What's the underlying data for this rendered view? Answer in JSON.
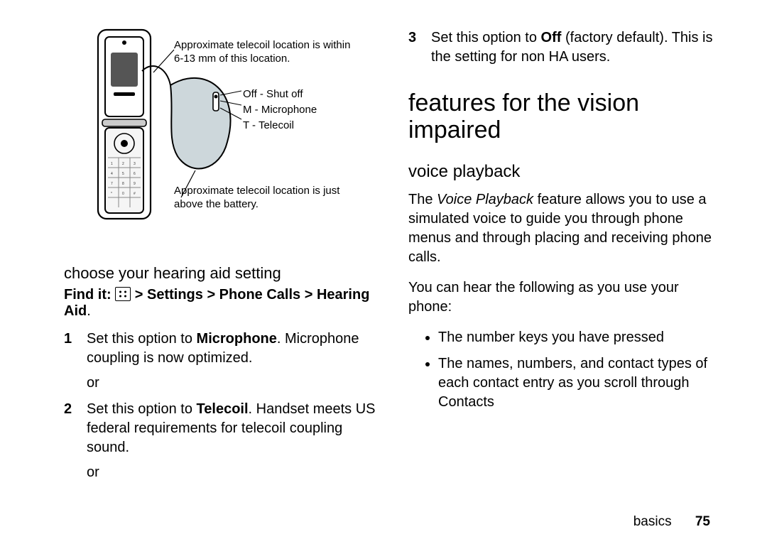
{
  "diagram": {
    "label_top": "Approximate telecoil location is within 6-13 mm of this location.",
    "legend_off": "Off - Shut off",
    "legend_m": "M - Microphone",
    "legend_t": "T - Telecoil",
    "label_bottom": "Approximate telecoil location is just above the battery."
  },
  "left": {
    "heading_choose": "choose your hearing aid setting",
    "findit_prefix": "Find it:",
    "findit_path": " > Settings > Phone Calls > Hearing Aid",
    "step1_a": "Set this option to ",
    "step1_bold": "Microphone",
    "step1_b": ". Microphone coupling is now optimized.",
    "or": "or",
    "step2_a": "Set this option to ",
    "step2_bold": "Telecoil",
    "step2_b": ". Handset meets US federal requirements for telecoil coupling sound."
  },
  "right": {
    "step3_a": "Set this option to ",
    "step3_bold": "Off",
    "step3_b": " (factory default). This is the setting for non HA users.",
    "section_title": "features for the vision impaired",
    "sub_title": "voice playback",
    "para1_a": "The ",
    "para1_ital": "Voice Playback",
    "para1_b": " feature allows you to use a simulated voice to guide you through phone menus and through placing and receiving phone calls.",
    "para2": "You can hear the following as you use your phone:",
    "bullet1": "The number keys you have pressed",
    "bullet2": "The names, numbers, and contact types of each contact entry as you scroll through Contacts"
  },
  "footer": {
    "section": "basics",
    "page": "75"
  }
}
